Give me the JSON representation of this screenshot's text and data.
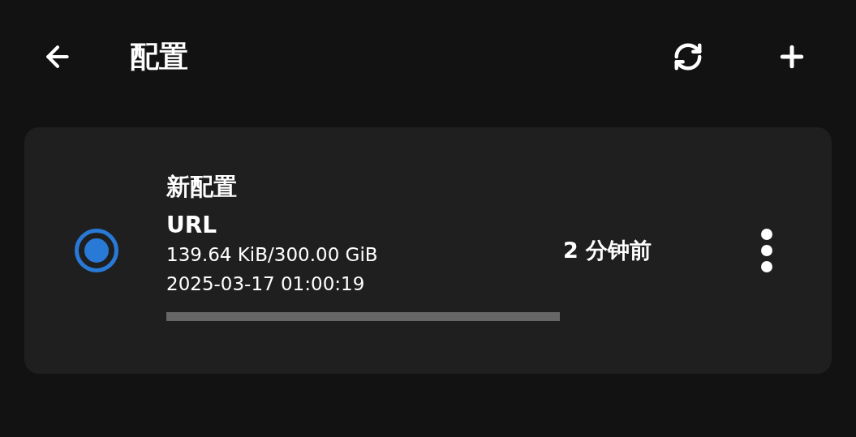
{
  "app_bar": {
    "title": "配置"
  },
  "profiles": [
    {
      "name": "新配置",
      "type": "URL",
      "usage": "139.64 KiB/300.00 GiB",
      "updated_at": "2025-03-17 01:00:19",
      "level": 0,
      "last_update": "2 分钟前",
      "selected": true
    }
  ]
}
